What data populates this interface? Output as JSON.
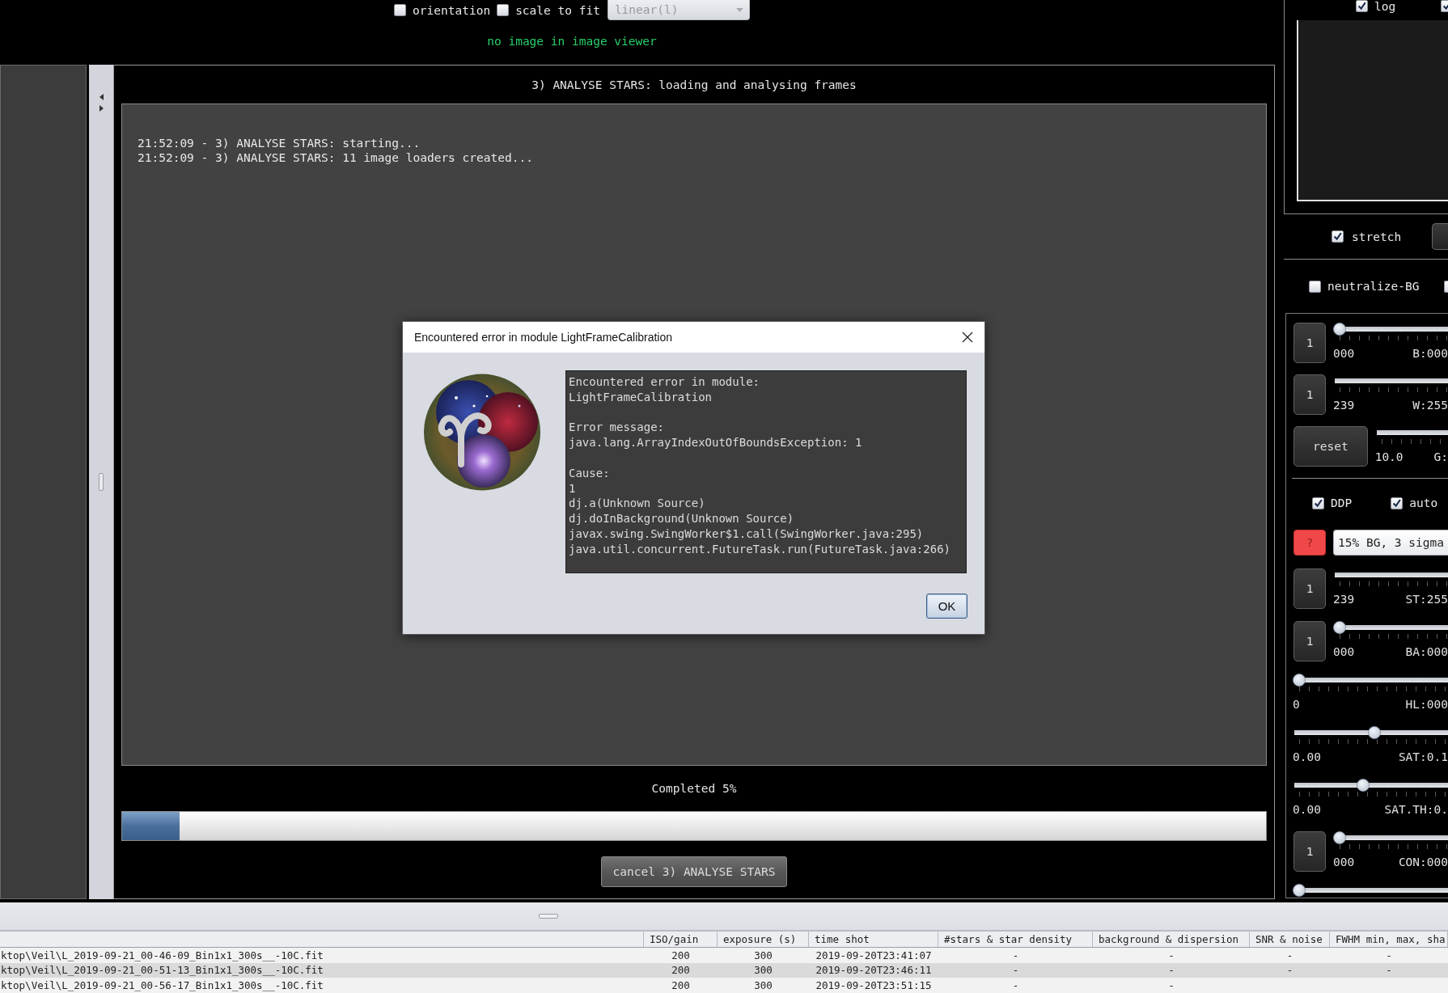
{
  "top_bar": {
    "toggles": [
      {
        "label": "orientation",
        "checked": false
      },
      {
        "label": "scale to fit",
        "checked": false
      }
    ],
    "stretch_mode": {
      "value": "linear(l)",
      "disabled": true
    },
    "status": "no image in image viewer"
  },
  "task": {
    "title": "3) ANALYSE STARS: loading and analysing frames",
    "log": [
      "21:52:09 - 3) ANALYSE STARS: starting...",
      "21:52:09 - 3) ANALYSE STARS: 11 image loaders created..."
    ],
    "progress": {
      "label": "Completed 5%",
      "level": 0.05
    },
    "cancel_button": "cancel 3) ANALYSE STARS"
  },
  "right_panel": {
    "log_toggles": [
      {
        "label": "log",
        "checked": true
      },
      {
        "checked": true
      }
    ],
    "stretch_toggle": {
      "label": "stretch",
      "checked": true
    },
    "bg_toggles": [
      {
        "label": "neutralize-BG",
        "checked": false
      },
      {
        "checked": false
      }
    ],
    "sliders_top": [
      {
        "kind": "stepper",
        "button": "1",
        "min_label": "000",
        "value_label": "B:000",
        "level": 0
      },
      {
        "kind": "stepper",
        "button": "1",
        "min_label": "239",
        "value_label": "W:255"
      },
      {
        "kind": "stepper",
        "button": "reset",
        "min_label": "10.0",
        "value_label": "G:"
      }
    ],
    "options": [
      {
        "label": "DDP",
        "checked": true
      },
      {
        "label": "auto",
        "checked": true
      }
    ],
    "preset": {
      "help_button": "?",
      "value": "15% BG, 3 sigma"
    },
    "sliders_bottom": [
      {
        "kind": "stepper",
        "button": "1",
        "min_label": "239",
        "value_label": "ST:255"
      },
      {
        "kind": "stepper",
        "button": "1",
        "min_label": "000",
        "value_label": "BA:000",
        "level": 0
      },
      {
        "kind": "plain",
        "min_label": "0",
        "value_label": "HL:000",
        "level": 0
      },
      {
        "kind": "plain",
        "min_label": "0.00",
        "value_label": "SAT:0.1",
        "level": 0.53
      },
      {
        "kind": "plain",
        "min_label": "0.00",
        "value_label": "SAT.TH:0.",
        "level": 0.45
      },
      {
        "kind": "stepper",
        "button": "1",
        "min_label": "000",
        "value_label": "CON:000",
        "level": 0
      },
      {
        "kind": "plain",
        "level": 0
      }
    ]
  },
  "file_table": {
    "columns": [
      "",
      "ISO/gain",
      "exposure (s)",
      "time shot",
      "#stars & star density",
      "background & dispersion",
      "SNR & noise",
      "FWHM min, max, sha"
    ],
    "rows": [
      {
        "cells": [
          "ktop\\Veil\\L_2019-09-21_00-46-09_Bin1x1_300s__-10C.fit",
          "200",
          "300",
          "2019-09-20T23:41:07",
          "-",
          "-",
          "-",
          "-"
        ]
      },
      {
        "cells": [
          "ktop\\Veil\\L_2019-09-21_00-51-13_Bin1x1_300s__-10C.fit",
          "200",
          "300",
          "2019-09-20T23:46:11",
          "-",
          "-",
          "-",
          "-"
        ]
      },
      {
        "cells": [
          "ktop\\Veil\\L_2019-09-21_00-56-17_Bin1x1_300s__-10C.fit",
          "200",
          "300",
          "2019-09-20T23:51:15",
          "-",
          "-"
        ]
      }
    ]
  },
  "error_dialog": {
    "title": "Encountered error in module LightFrameCalibration",
    "message_blocks": [
      [
        "Encountered error in module:",
        "LightFrameCalibration"
      ],
      [
        "Error message:",
        "java.lang.ArrayIndexOutOfBoundsException: 1"
      ],
      [
        "Cause:",
        "1",
        "dj.a(Unknown Source)",
        "dj.doInBackground(Unknown Source)",
        "javax.swing.SwingWorker$1.call(SwingWorker.java:295)",
        "java.util.concurrent.FutureTask.run(FutureTask.java:266)"
      ]
    ],
    "ok_button": "OK"
  }
}
